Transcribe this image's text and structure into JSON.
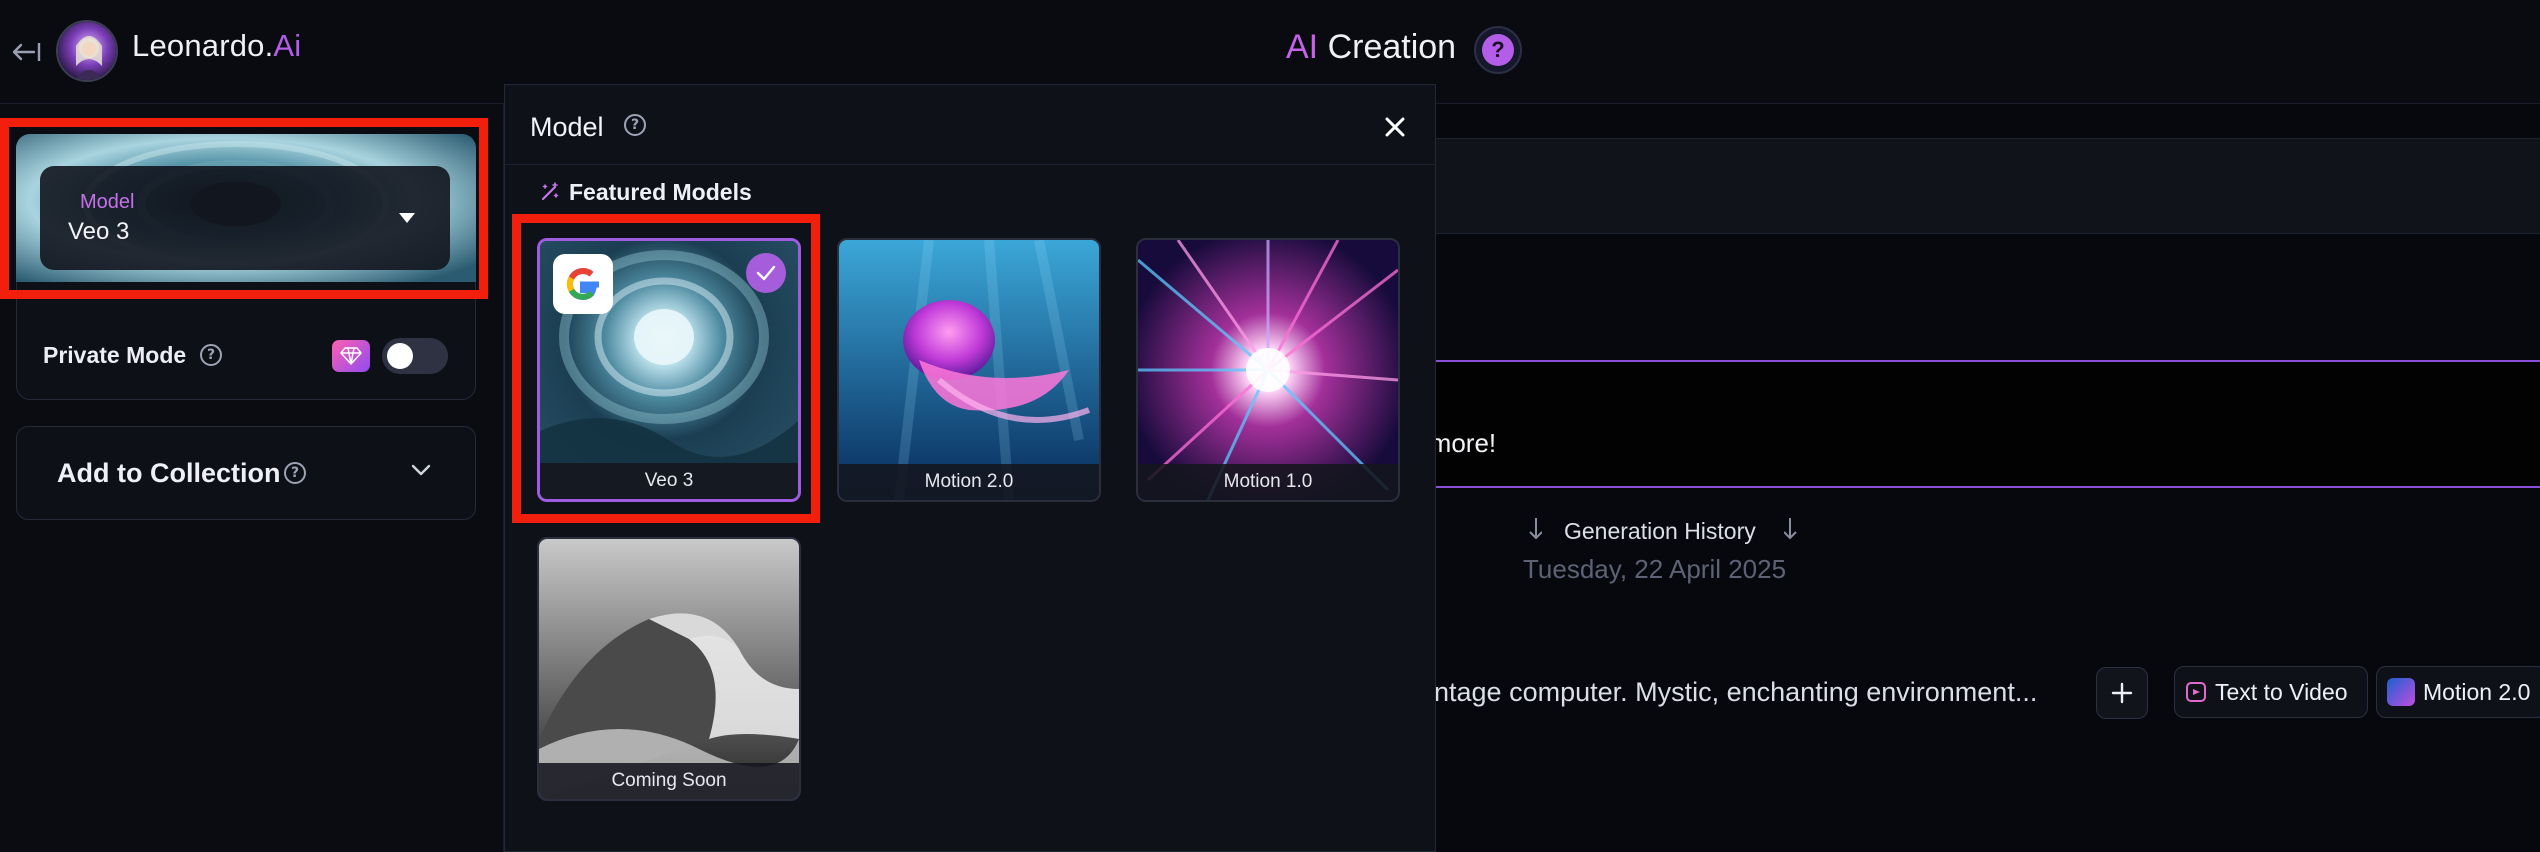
{
  "header": {
    "brand_part1": "Leonardo.",
    "brand_part2": "Ai",
    "title_ai": "AI",
    "title_rest": " Creation",
    "help_symbol": "?"
  },
  "sidebar": {
    "model_selector": {
      "label": "Model",
      "value": "Veo 3"
    },
    "private_mode": {
      "label": "Private Mode",
      "enabled": false
    },
    "collection": {
      "label": "Add to Collection"
    }
  },
  "dialog": {
    "title": "Model",
    "featured_label": "Featured Models",
    "models": [
      {
        "name": "Veo 3",
        "selected": true
      },
      {
        "name": "Motion 2.0",
        "selected": false
      },
      {
        "name": "Motion 1.0",
        "selected": false
      },
      {
        "name": "Coming Soon",
        "selected": false
      }
    ]
  },
  "background": {
    "banner_text": "n more!",
    "generation_history": "Generation History",
    "date": "Tuesday, 22 April 2025",
    "prompt": "intage computer. Mystic, enchanting environment...",
    "chips": {
      "mode": "Text to Video",
      "model": "Motion 2.0"
    }
  },
  "colors": {
    "accent": "#b35de8",
    "highlight_box": "#f21f0c",
    "background": "#07080d",
    "panel": "#0f1119"
  },
  "icons": [
    "back-arrow-icon",
    "help-icon",
    "caret-down-icon",
    "info-icon",
    "gem-icon",
    "chevron-down-icon",
    "close-icon",
    "magic-wand-icon",
    "google-logo-icon",
    "check-icon",
    "plus-icon",
    "video-icon",
    "arrow-down-icon"
  ]
}
